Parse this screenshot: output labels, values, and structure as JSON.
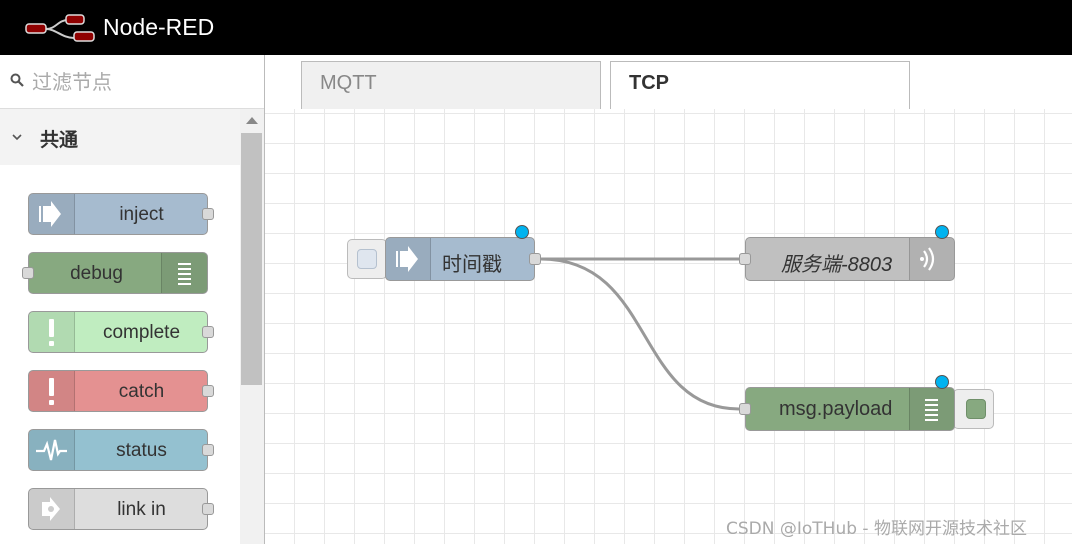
{
  "app": {
    "title": "Node-RED"
  },
  "palette": {
    "filter_placeholder": "过滤节点",
    "category": "共通",
    "nodes": [
      {
        "label": "inject",
        "color": "#a6bbcf",
        "icon": "arrow-in-icon",
        "ports": "right"
      },
      {
        "label": "debug",
        "color": "#87a980",
        "icon": "list-icon",
        "ports": "left"
      },
      {
        "label": "complete",
        "color": "#c0edc0",
        "icon": "exclamation-icon",
        "ports": "right"
      },
      {
        "label": "catch",
        "color": "#e49191",
        "icon": "exclamation-icon",
        "ports": "right"
      },
      {
        "label": "status",
        "color": "#94c1d0",
        "icon": "pulse-icon",
        "ports": "right"
      },
      {
        "label": "link in",
        "color": "#dddddd",
        "icon": "link-in-icon",
        "ports": "right"
      }
    ]
  },
  "tabs": [
    {
      "label": "MQTT",
      "active": false
    },
    {
      "label": "TCP",
      "active": true
    }
  ],
  "flow": {
    "inject_node": {
      "label": "时间戳",
      "color": "#a6bbcf"
    },
    "tcp_node": {
      "label": "服务端-8803",
      "color": "#c0c0c0"
    },
    "debug_node": {
      "label": "msg.payload",
      "color": "#87a980"
    }
  },
  "watermark": "CSDN @IoTHub - 物联网开源技术社区"
}
